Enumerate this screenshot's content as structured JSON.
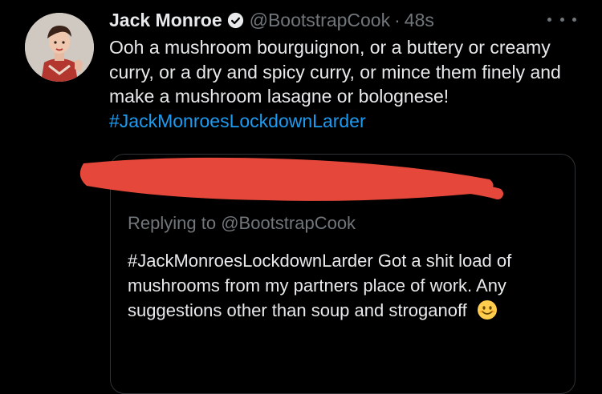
{
  "tweet": {
    "author_name": "Jack Monroe",
    "handle": "@BootstrapCook",
    "separator": "·",
    "time": "48s",
    "text": "Ooh a mushroom bourguignon, or a buttery or creamy curry, or a dry and spicy curry, or mince them finely and make a mushroom lasagne or bolognese!",
    "hashtag": "#JackMonroesLockdownLarder"
  },
  "quoted_tweet": {
    "replying_prefix": "Replying to",
    "replying_handle": "@BootstrapCook",
    "hashtag": "#JackMonroesLockdownLarder",
    "text": "Got a shit load of mushrooms from my partners place of work. Any suggestions other than soup and stroganoff"
  },
  "icons": [
    "avatar",
    "verified-badge-icon",
    "more-options-icon",
    "smiling-face-emoji-icon"
  ],
  "colors": {
    "background": "#000000",
    "text": "#e7e9ea",
    "secondary": "#71767b",
    "link": "#1d9bf0",
    "redaction": "#e5483a"
  }
}
